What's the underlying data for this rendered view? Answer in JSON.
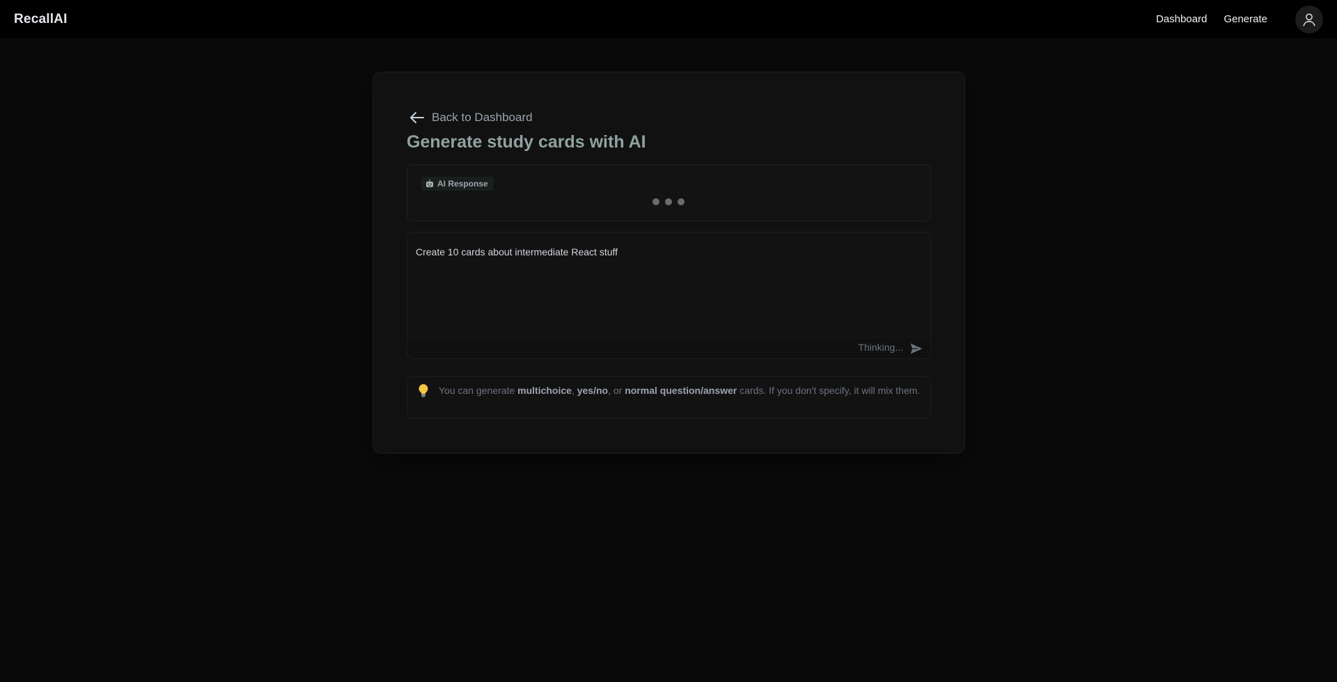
{
  "navbar": {
    "brand": "RecallAI",
    "links": [
      "Dashboard",
      "Generate"
    ],
    "user_icon": "user-icon"
  },
  "page": {
    "back_label": "Back to Dashboard",
    "back_icon": "arrow-left-icon",
    "title": "Generate study cards with AI"
  },
  "ai_response": {
    "badge_icon": "robot-icon",
    "badge_label": "AI Response",
    "loading_dots": 3
  },
  "prompt": {
    "value": "Create 10 cards about intermediate React stuff",
    "status": "Thinking...",
    "send_icon": "send-icon"
  },
  "tip": {
    "icon": "lightbulb-icon",
    "prefix": "You can generate ",
    "type1": "multichoice",
    "sep1": ", ",
    "type2": "yes/no",
    "sep2": ", or ",
    "type3": "normal question/answer",
    "suffix": " cards. If you don't specify, it will mix them."
  },
  "colors": {
    "background": "#0a0a0a",
    "navbar": "#000000",
    "card": "#111111",
    "title": "#8fa3a0",
    "muted": "#6b7280"
  }
}
